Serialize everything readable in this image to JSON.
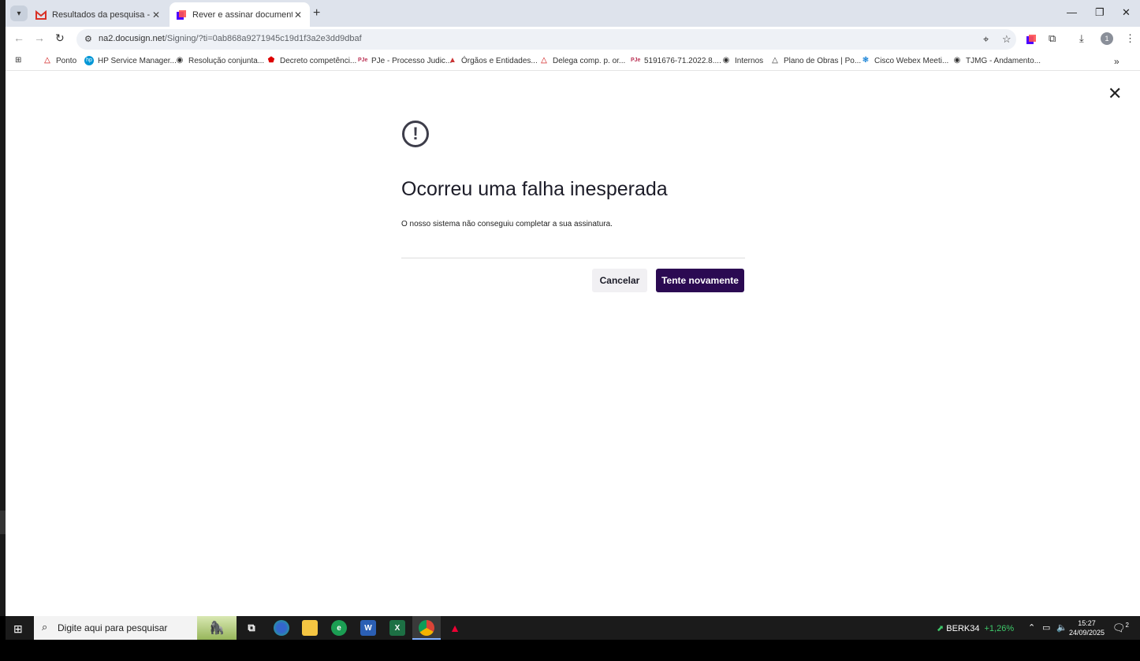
{
  "browser": {
    "tabs": [
      {
        "title": "Resultados da pesquisa - tjemg",
        "favicon": "gmail-icon",
        "active": false
      },
      {
        "title": "Rever e assinar documento(s) | Docusign",
        "favicon": "docusign-icon",
        "active": true
      }
    ],
    "url": {
      "host": "na2.docusign.net",
      "path": "/Signing/?ti=0ab868a9271945c19d1f3a2e3dd9dbaf"
    },
    "profile_initial": "1",
    "bookmarks": [
      {
        "label": "Ponto",
        "icon": "warning-icon"
      },
      {
        "label": "HP Service Manager...",
        "icon": "hp-icon"
      },
      {
        "label": "Resolução conjunta...",
        "icon": "globe-icon"
      },
      {
        "label": "Decreto competênci...",
        "icon": "adobe-icon"
      },
      {
        "label": "PJe - Processo Judic...",
        "icon": "pje-icon"
      },
      {
        "label": "Órgãos e Entidades...",
        "icon": "triangle-icon"
      },
      {
        "label": "Delega comp. p. or...",
        "icon": "warning-icon"
      },
      {
        "label": "5191676-71.2022.8....",
        "icon": "pje-icon"
      },
      {
        "label": "Internos",
        "icon": "globe-icon"
      },
      {
        "label": "Plano de Obras | Po...",
        "icon": "triangle-icon"
      },
      {
        "label": "Cisco Webex Meeti...",
        "icon": "webex-icon"
      },
      {
        "label": "TJMG - Andamento...",
        "icon": "globe-icon"
      }
    ]
  },
  "dialog": {
    "title": "Ocorreu uma falha inesperada",
    "message": "O nosso sistema não conseguiu completar a sua assinatura.",
    "cancel_label": "Cancelar",
    "retry_label": "Tente novamente",
    "primary_color": "#2b0a52"
  },
  "taskbar": {
    "search_placeholder": "Digite aqui para pesquisar",
    "stock_symbol": "BERK34",
    "stock_change": "+1,26%",
    "time": "15:27",
    "date": "24/09/2025",
    "notification_count": "2"
  }
}
